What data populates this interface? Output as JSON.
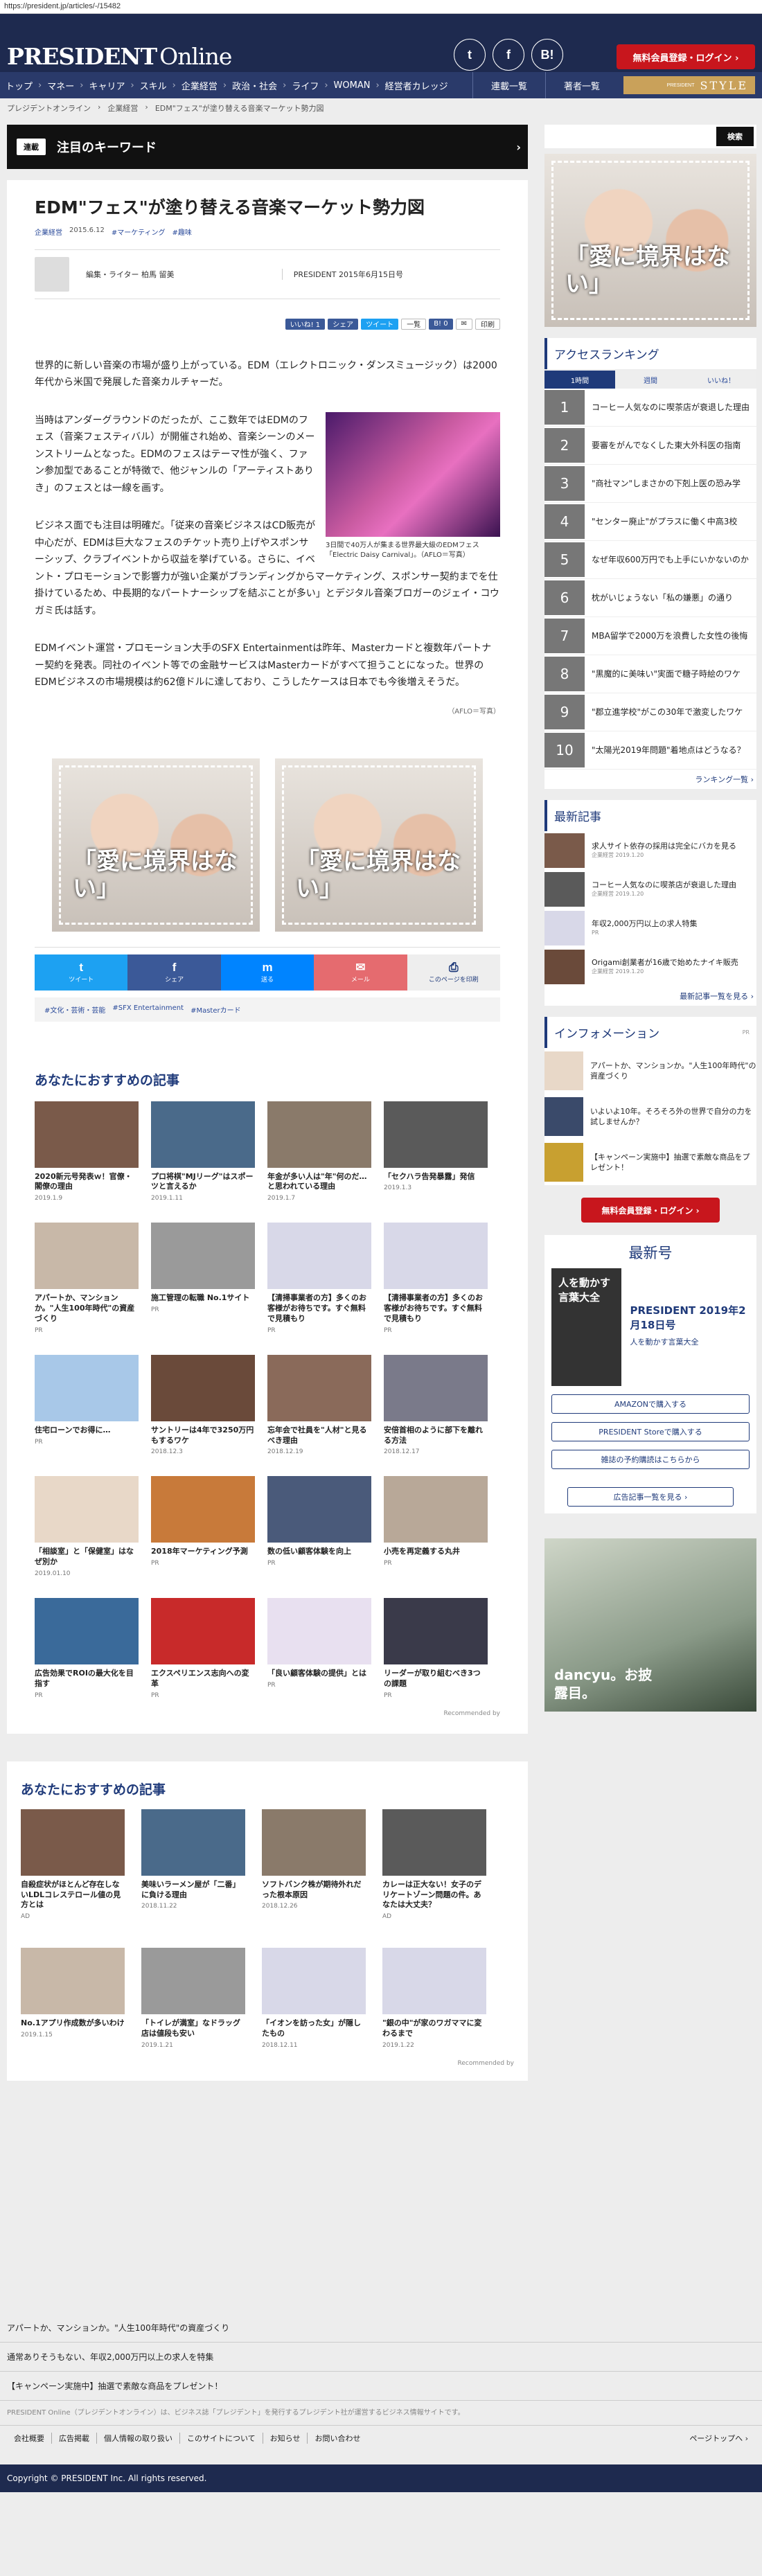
{
  "url": "https://president.jp/articles/-/15482",
  "header": {
    "logo_main": "PRESIDENT",
    "logo_sub": "Online",
    "social": [
      "t",
      "f",
      "B!"
    ],
    "register_login": "無料会員登録・ログイン ›"
  },
  "nav": {
    "items": [
      "トップ",
      "マネー",
      "キャリア",
      "スキル",
      "企業経営",
      "政治・社会",
      "ライフ",
      "WOMAN",
      "経営者カレッジ"
    ],
    "right": [
      "連載一覧",
      "著者一覧"
    ],
    "style_small": "PRESIDENT",
    "style_label": "STYLE"
  },
  "breadcrumb": [
    "プレジデントオンライン",
    "企業経営",
    "EDM\"フェス\"が塗り替える音楽マーケット勢力図"
  ],
  "keyword_bar": {
    "tag": "連載",
    "label": "注目のキーワード",
    "arrow": "›"
  },
  "article": {
    "title": "EDM\"フェス\"が塗り替える音楽マーケット勢力図",
    "category": "企業経営",
    "date": "2015.6.12",
    "tags_inline": [
      "#マーケティング",
      "#趣味"
    ],
    "author": "編集・ライター 柏馬 留美",
    "publication": "PRESIDENT 2015年6月15日号",
    "share_small": [
      "いいね! 1",
      "シェア",
      "ツイート",
      "一覧",
      "B! 0",
      "✉",
      "印刷"
    ],
    "paragraphs": [
      "世界的に新しい音楽の市場が盛り上がっている。EDM（エレクトロニック・ダンスミュージック）は2000年代から米国で発展した音楽カルチャーだ。",
      "当時はアンダーグラウンドのだったが、ここ数年ではEDMのフェス（音楽フェスティバル）が開催され始め、音楽シーンのメーンストリームとなった。EDMのフェスはテーマ性が強く、ファン参加型であることが特徴で、他ジャンルの「アーティストありき」のフェスとは一線を画す。",
      "ビジネス面でも注目は明確だ。「従来の音楽ビジネスはCD販売が中心だが、EDMは巨大なフェスのチケット売り上げやスポンサーシップ、クラブイベントから収益を挙げている。さらに、イベント・プロモーションで影響力が強い企業がブランディングからマーケティング、スポンサー契約までを仕掛けているため、中長期的なパートナーシップを結ぶことが多い」とデジタル音楽ブロガーのジェイ・コウガミ氏は話す。",
      "EDMイベント運営・プロモーション大手のSFX Entertainmentは昨年、Masterカードと複数年パートナー契約を発表。同社のイベント等での金融サービスはMasterカードがすべて担うことになった。世界のEDMビジネスの市場規模は約62億ドルに達しており、こうしたケースは日本でも今後増えそうだ。"
    ],
    "figure_caption": "3日間で40万人が集まる世界最大級のEDMフェス「Electric Daisy Carnival」。（AFLO＝写真）",
    "credit": "（AFLO＝写真）",
    "ad_text": "「愛に境界はない」",
    "sharebar": [
      {
        "icon": "t",
        "label": "ツイート",
        "color": "#1da1f2"
      },
      {
        "icon": "f",
        "label": "シェア",
        "color": "#3b5998"
      },
      {
        "icon": "m",
        "label": "送る",
        "color": "#0084ff"
      },
      {
        "icon": "✉",
        "label": "メール",
        "color": "#e56b6f"
      },
      {
        "icon": "⎙",
        "label": "このページを印刷",
        "color": "#eeeeee"
      }
    ],
    "tags": [
      "#文化・芸術・芸能",
      "#SFX Entertainment",
      "#Masterカード"
    ]
  },
  "recommend": {
    "heading": "あなたにおすすめの記事",
    "items": [
      {
        "title": "2020新元号発表ｗ！官僚・閣僚の理由",
        "sub": "2019.1.9"
      },
      {
        "title": "プロ将棋\"MJリーグ\"はスポーツと言えるか",
        "sub": "2019.1.11"
      },
      {
        "title": "年金が多い人は\"年\"何のだ…と思われている理由",
        "sub": "2019.1.7"
      },
      {
        "title": "「セクハラ告発暴露」発信",
        "sub": "2019.1.3"
      },
      {
        "title": "アパートか、マンションか。\"人生100年時代\"の資産づくり",
        "sub": "PR"
      },
      {
        "title": "施工管理の転職 No.1サイト",
        "sub": "PR"
      },
      {
        "title": "【清掃事業者の方】多くのお客様がお待ちです。すぐ無料で見積もり",
        "sub": "PR"
      },
      {
        "title": "【清掃事業者の方】多くのお客様がお待ちです。すぐ無料で見積もり",
        "sub": "PR"
      },
      {
        "title": "住宅ローンでお得に…",
        "sub": "PR"
      },
      {
        "title": "サントリーは4年で3250万円もするワケ",
        "sub": "2018.12.3"
      },
      {
        "title": "忘年会で社員を\"人材\"と見るべき理由",
        "sub": "2018.12.19"
      },
      {
        "title": "安倍首相のように部下を離れる方法",
        "sub": "2018.12.17"
      },
      {
        "title": "「相談室」と「保健室」はなぜ別か",
        "sub": "2019.01.10"
      },
      {
        "title": "2018年マーケティング予測",
        "sub": "PR"
      },
      {
        "title": "数の低い顧客体験を向上",
        "sub": "PR"
      },
      {
        "title": "小売を再定義する丸井",
        "sub": "PR"
      },
      {
        "title": "広告効果でROIの最大化を目指す",
        "sub": "PR"
      },
      {
        "title": "エクスペリエンス志向への変革",
        "sub": "PR"
      },
      {
        "title": "「良い顧客体験の提供」とは",
        "sub": "PR"
      },
      {
        "title": "リーダーが取り組むべき3つの課題",
        "sub": "PR"
      }
    ],
    "by": "Recommended by"
  },
  "recommend2": {
    "heading": "あなたにおすすめの記事",
    "items": [
      {
        "title": "自殺症状がほとんど存在しないLDLコレステロール値の見方とは",
        "sub": "AD"
      },
      {
        "title": "美味いラーメン屋が「二番」に負ける理由",
        "sub": "2018.11.22"
      },
      {
        "title": "ソフトバンク株が期待外れだった根本原因",
        "sub": "2018.12.26"
      },
      {
        "title": "カレーは正大ない！女子のデリケートゾーン問題の件。あなたは大丈夫？",
        "sub": "AD"
      },
      {
        "title": "No.1アプリ作成数が多いわけ",
        "sub": "2019.1.15"
      },
      {
        "title": "「トイレが満室」なドラッグ店は値段も安い",
        "sub": "2019.1.21"
      },
      {
        "title": "「イオンを訪った女」が隠したもの",
        "sub": "2018.12.11"
      },
      {
        "title": "\"銀の中\"が家のワガママに変わるまで",
        "sub": "2019.1.22"
      }
    ],
    "by": "Recommended by"
  },
  "sidebar": {
    "search": "検索",
    "ranking_title": "アクセスランキング",
    "ranking_tabs": [
      "1時間",
      "週間",
      "いいね！"
    ],
    "ranking": [
      "コーヒー人気なのに喫茶店が衰退した理由",
      "要審をがんでなくした東大外科医の指南",
      "\"商社マン\"しまさかの下剋上医の恐み学",
      "\"センター廃止\"がプラスに働く中高3校",
      "なぜ年収600万円でも上手にいかないのか",
      "枕がいじょうない「私の嫌悪」の通り",
      "MBA留学で2000万を浪費した女性の後悔",
      "\"黒魔的に美味い\"実面で糖子時絵のワケ",
      "\"郡立進学校\"がこの30年で激変したワケ",
      "\"太陽光2019年問題\"着地点はどうなる？"
    ],
    "ranking_more": "ランキング一覧 ›",
    "latest_title": "最新記事",
    "latest": [
      {
        "title": "求人サイト依存の採用は完全にバカを見る",
        "sub": "企業経営 2019.1.20"
      },
      {
        "title": "コーヒー人気なのに喫茶店が衰退した理由",
        "sub": "企業経営 2019.1.20"
      },
      {
        "title": "年収2,000万円以上の求人特集",
        "sub": "PR"
      },
      {
        "title": "Origami創業者が16歳で始めたナイキ販売",
        "sub": "企業経営 2019.1.20"
      }
    ],
    "latest_more": "最新記事一覧を見る ›",
    "info_title": "インフォメーション",
    "info": [
      "アパートか、マンションか。\"人生100年時代\"の資産づくり",
      "いよいよ10年。そろそろ外の世界で自分の力を試しませんか？",
      "【キャンペーン実施中】抽選で素敵な商品をプレゼント！"
    ],
    "register": "無料会員登録・ログイン ›",
    "mag_heading": "最新号",
    "mag_cover": "人を動かす言葉大全",
    "mag_title": "PRESIDENT 2019年2月18日号",
    "mag_sub": "人を動かす言葉大全",
    "mag_buttons": [
      "AMAZONで購入する",
      "PRESIDENT Storeで購入する",
      "雑誌の予約購読はこちらから"
    ],
    "ad_list": "広告記事一覧を見る ›",
    "ad2_text": "dancyu。お披露目。"
  },
  "footer": {
    "pr_links": [
      "アパートか、マンションか。\"人生100年時代\"の資産づくり",
      "通常ありそうもない、年収2,000万円以上の求人を特集",
      "【キャンペーン実施中】抽選で素敵な商品をプレゼント！"
    ],
    "note": "PRESIDENT Online（プレジデントオンライン）は、ビジネス誌「プレジデント」を発行するプレジデント社が運営するビジネス情報サイトです。",
    "nav": [
      "会社概要",
      "広告掲載",
      "個人情報の取り扱い",
      "このサイトについて",
      "お知らせ",
      "お問い合わせ"
    ],
    "pagetop": "ページトップへ ›",
    "copyright": "Copyright © PRESIDENT Inc. All rights reserved."
  }
}
